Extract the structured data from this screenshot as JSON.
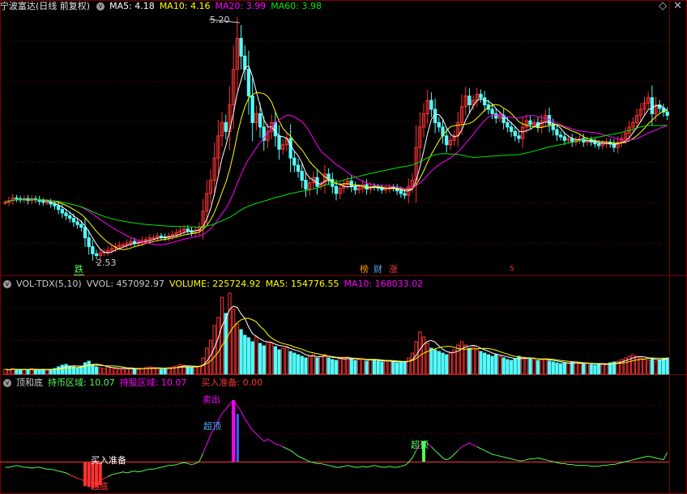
{
  "header": {
    "title": "宁波富达(日线 前复权)",
    "ma5": "MA5: 4.18",
    "ma10": "MA10: 4.16",
    "ma20": "MA20: 3.99",
    "ma60": "MA60: 3.98",
    "right_icons": [
      "diamond-icon",
      "close-icon"
    ]
  },
  "main_panel": {
    "high_label": "5.20",
    "low_label": "2.53",
    "tags": [
      {
        "name": "die",
        "text": "跌"
      },
      {
        "name": "bang",
        "text": "榜"
      },
      {
        "name": "cai",
        "text": "财"
      },
      {
        "name": "zhang",
        "text": "涨"
      },
      {
        "name": "s",
        "text": "S"
      }
    ]
  },
  "volume_panel": {
    "name": "VOL-TDX(5,10)",
    "vvol": "VVOL: 457092.97",
    "volume": "VOLUME: 225724.92",
    "ma5": "MA5: 154776.55",
    "ma10": "MA10: 168033.02"
  },
  "indicator_panel": {
    "name": "顶和底",
    "hold_cash": "持币区域: 10.07",
    "hold_stock": "持股区域: 10.07",
    "buy_ready": "买入准备: 0.00",
    "annotations": {
      "buy": "买入准备",
      "bottom": "超底",
      "top1": "超顶",
      "sell": "卖出",
      "top2": "超顶"
    }
  },
  "colors": {
    "up": "#ff3232",
    "down": "#54fcfc",
    "ma5": "#ffffff",
    "ma10": "#ffff00",
    "ma20": "#ff00ff",
    "ma60": "#00e600",
    "grid": "#7a0000"
  },
  "chart_data": [
    {
      "type": "candlestick",
      "title": "宁波富达(日线 前复权)",
      "notes": "Approximate reading of the daily price path",
      "y_markers": {
        "high": 5.2,
        "low": 2.53
      },
      "close": [
        3.2,
        3.22,
        3.25,
        3.24,
        3.23,
        3.24,
        3.22,
        3.24,
        3.23,
        3.21,
        3.2,
        3.2,
        3.18,
        3.16,
        3.12,
        3.08,
        3.05,
        3.02,
        2.98,
        2.95,
        2.92,
        2.8,
        2.7,
        2.62,
        2.6,
        2.63,
        2.64,
        2.66,
        2.68,
        2.7,
        2.72,
        2.72,
        2.74,
        2.76,
        2.74,
        2.75,
        2.77,
        2.78,
        2.8,
        2.8,
        2.82,
        2.81,
        2.8,
        2.82,
        2.84,
        2.86,
        2.88,
        2.9,
        2.88,
        2.86,
        2.88,
        2.92,
        3.1,
        3.3,
        3.45,
        3.7,
        3.95,
        4.1,
        4.0,
        4.3,
        4.7,
        5.05,
        4.85,
        4.7,
        4.4,
        4.1,
        4.2,
        4.05,
        3.9,
        4.0,
        4.1,
        3.95,
        3.8,
        3.85,
        3.92,
        3.7,
        3.62,
        3.55,
        3.45,
        3.35,
        3.42,
        3.48,
        3.38,
        3.4,
        3.52,
        3.46,
        3.38,
        3.3,
        3.36,
        3.4,
        3.44,
        3.38,
        3.34,
        3.36,
        3.4,
        3.35,
        3.38,
        3.37,
        3.36,
        3.34,
        3.35,
        3.37,
        3.36,
        3.33,
        3.3,
        3.28,
        3.38,
        3.45,
        3.82,
        4.05,
        4.2,
        4.35,
        4.25,
        4.1,
        4.05,
        3.95,
        3.85,
        3.9,
        3.95,
        4.1,
        4.28,
        4.4,
        4.3,
        4.35,
        4.42,
        4.38,
        4.3,
        4.25,
        4.2,
        4.15,
        4.18,
        4.1,
        4.05,
        4.0,
        3.95,
        3.92,
        4.05,
        4.12,
        4.08,
        4.1,
        4.05,
        4.12,
        4.18,
        4.08,
        4.02,
        3.96,
        3.94,
        3.9,
        3.92,
        3.88,
        3.9,
        3.92,
        3.88,
        3.9,
        3.88,
        3.86,
        3.84,
        3.86,
        3.88,
        3.86,
        3.82,
        3.88,
        3.92,
        3.98,
        4.05,
        4.1,
        4.18,
        4.25,
        4.32,
        4.38,
        4.2,
        4.3,
        4.26,
        4.22,
        4.18
      ]
    },
    {
      "type": "bar",
      "title": "VOL-TDX(5,10)",
      "notes": "Relative daily volume, approximate scale 0-100",
      "values": [
        6,
        5,
        7,
        6,
        5,
        6,
        5,
        7,
        6,
        5,
        6,
        5,
        6,
        7,
        9,
        11,
        12,
        10,
        9,
        8,
        10,
        14,
        16,
        12,
        9,
        8,
        7,
        9,
        8,
        7,
        6,
        6,
        7,
        8,
        6,
        6,
        7,
        8,
        9,
        8,
        7,
        6,
        7,
        8,
        9,
        10,
        12,
        11,
        9,
        8,
        9,
        10,
        20,
        32,
        42,
        60,
        70,
        95,
        75,
        100,
        80,
        62,
        55,
        48,
        45,
        40,
        46,
        38,
        35,
        40,
        38,
        34,
        30,
        32,
        34,
        28,
        26,
        24,
        22,
        20,
        22,
        24,
        20,
        22,
        24,
        20,
        18,
        17,
        19,
        20,
        21,
        18,
        17,
        18,
        19,
        16,
        18,
        17,
        16,
        15,
        16,
        17,
        15,
        14,
        15,
        14,
        20,
        26,
        40,
        52,
        46,
        38,
        32,
        30,
        28,
        26,
        24,
        26,
        30,
        36,
        40,
        36,
        32,
        34,
        30,
        28,
        26,
        24,
        22,
        24,
        22,
        20,
        18,
        17,
        19,
        22,
        20,
        19,
        20,
        18,
        17,
        18,
        19,
        16,
        15,
        14,
        13,
        14,
        13,
        15,
        14,
        13,
        14,
        13,
        12,
        11,
        12,
        13,
        12,
        14,
        15,
        16,
        18,
        20,
        22,
        24,
        22,
        20,
        18,
        17,
        20,
        16,
        18,
        19,
        20
      ]
    },
    {
      "type": "line",
      "title": "顶和底",
      "notes": "Oscillator, approximate relative values 0-100",
      "values": [
        20,
        20,
        21,
        22,
        21,
        20,
        20,
        19,
        20,
        20,
        19,
        18,
        18,
        17,
        16,
        15,
        14,
        12,
        10,
        8,
        7,
        5,
        4,
        3,
        4,
        6,
        8,
        10,
        12,
        13,
        14,
        15,
        14,
        15,
        16,
        15,
        16,
        17,
        18,
        18,
        19,
        20,
        21,
        22,
        22,
        23,
        24,
        25,
        24,
        23,
        24,
        26,
        35,
        45,
        55,
        62,
        70,
        78,
        82,
        88,
        92,
        86,
        80,
        72,
        66,
        60,
        56,
        52,
        48,
        50,
        48,
        45,
        44,
        42,
        40,
        38,
        35,
        32,
        30,
        28,
        26,
        25,
        24,
        24,
        23,
        22,
        21,
        20,
        20,
        21,
        22,
        21,
        20,
        20,
        21,
        20,
        21,
        22,
        21,
        20,
        20,
        21,
        20,
        20,
        21,
        22,
        25,
        30,
        38,
        44,
        48,
        46,
        42,
        38,
        34,
        30,
        28,
        30,
        34,
        38,
        42,
        44,
        46,
        44,
        42,
        40,
        38,
        36,
        34,
        33,
        32,
        31,
        30,
        29,
        28,
        27,
        27,
        28,
        29,
        29,
        30,
        29,
        28,
        27,
        26,
        25,
        24,
        24,
        23,
        23,
        22,
        22,
        22,
        22,
        21,
        21,
        21,
        22,
        22,
        23,
        23,
        24,
        25,
        26,
        27,
        28,
        29,
        30,
        31,
        32,
        31,
        30,
        29,
        28,
        36
      ]
    }
  ]
}
